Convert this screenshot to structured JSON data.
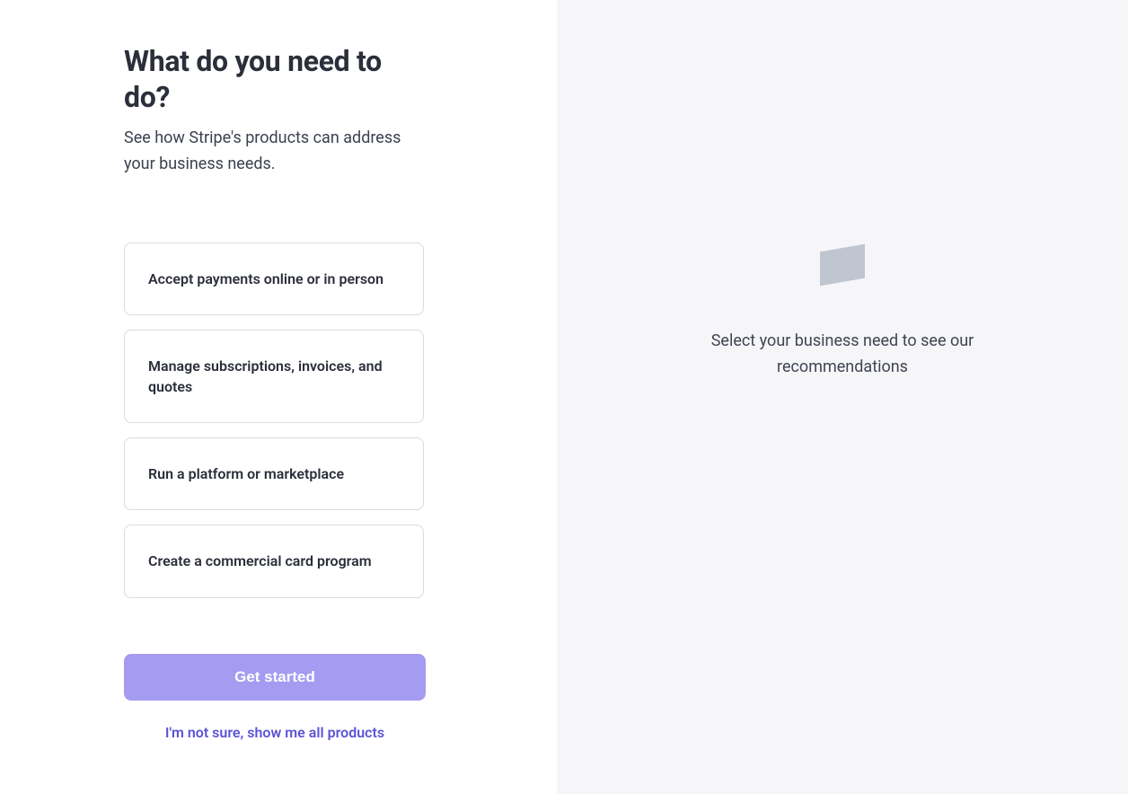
{
  "left": {
    "heading": "What do you need to do?",
    "subheading": "See how Stripe's products can address your business needs.",
    "options": [
      {
        "label": "Accept payments online or in person"
      },
      {
        "label": "Manage subscriptions, invoices, and quotes"
      },
      {
        "label": "Run a platform or marketplace"
      },
      {
        "label": "Create a commercial card program"
      }
    ],
    "primary_button": "Get started",
    "secondary_link": "I'm not sure, show me all products"
  },
  "right": {
    "placeholder_text": "Select your business need to see our recommendations"
  }
}
